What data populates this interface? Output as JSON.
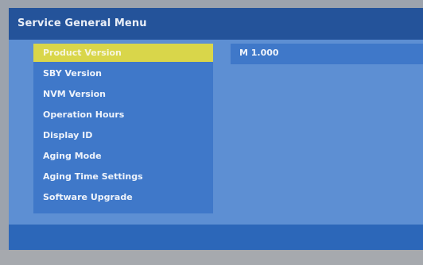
{
  "menu": {
    "title": "Service General Menu",
    "items": [
      {
        "label": "Product Version"
      },
      {
        "label": "SBY Version"
      },
      {
        "label": "NVM Version"
      },
      {
        "label": "Operation Hours"
      },
      {
        "label": "Display ID"
      },
      {
        "label": "Aging Mode"
      },
      {
        "label": "Aging Time Settings"
      },
      {
        "label": "Software Upgrade"
      }
    ],
    "selected_index": 0
  },
  "detail": {
    "value": "M 1.000"
  },
  "colors": {
    "title_bar": "#24539a",
    "panel": "#5d8fd3",
    "menu_bg": "#3f78c9",
    "selected_bg": "#d9d64a",
    "bottom_band": "#2c67b9"
  }
}
